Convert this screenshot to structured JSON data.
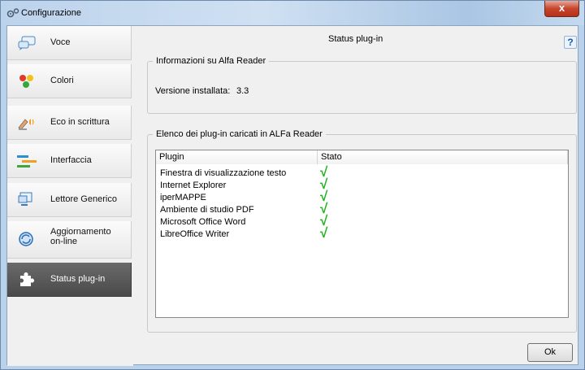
{
  "window": {
    "title": "Configurazione",
    "close_glyph": "x"
  },
  "sidebar": {
    "items": [
      {
        "label": "Voce",
        "icon": "speech-balloon-icon",
        "active": false
      },
      {
        "label": "Colori",
        "icon": "colors-icon",
        "active": false
      },
      {
        "label": "Eco in scrittura",
        "icon": "echo-writing-icon",
        "active": false
      },
      {
        "label": "Interfaccia",
        "icon": "interface-bars-icon",
        "active": false
      },
      {
        "label": "Lettore Generico",
        "icon": "monitor-icon",
        "active": false
      },
      {
        "label": "Aggiornamento on-line",
        "icon": "update-icon",
        "active": false
      },
      {
        "label": "Status plug-in",
        "icon": "puzzle-icon",
        "active": true
      }
    ]
  },
  "main": {
    "title": "Status plug-in",
    "help_glyph": "?",
    "info_group": {
      "legend": "Informazioni su Alfa Reader",
      "version_label": "Versione installata:",
      "version_value": "3.3"
    },
    "list_group": {
      "legend": "Elenco dei plug-in caricati in ALFa Reader",
      "columns": [
        "Plugin",
        "Stato"
      ],
      "check_glyph": "√",
      "rows": [
        {
          "name": "Finestra di visualizzazione testo",
          "loaded": true
        },
        {
          "name": "Internet Explorer",
          "loaded": true
        },
        {
          "name": "iperMAPPE",
          "loaded": true
        },
        {
          "name": "Ambiente di studio PDF",
          "loaded": true
        },
        {
          "name": "Microsoft Office Word",
          "loaded": true
        },
        {
          "name": "LibreOffice Writer",
          "loaded": true
        }
      ]
    },
    "ok_label": "Ok"
  },
  "colors": {
    "check_green": "#1db31d",
    "active_nav": "#555555",
    "help_blue": "#1e5aa8"
  }
}
